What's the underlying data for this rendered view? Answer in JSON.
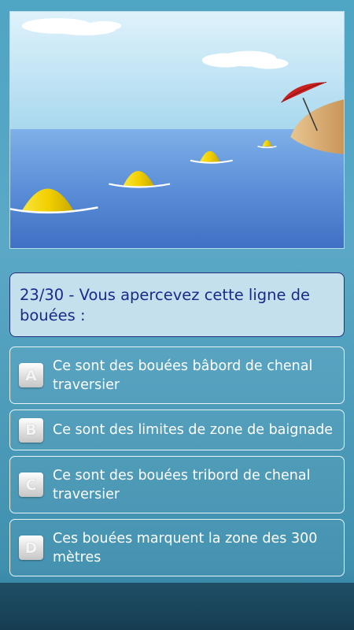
{
  "quiz": {
    "question": "23/30 - Vous apercevez cette ligne de bouées :",
    "answers": [
      {
        "letter": "A",
        "text": "Ce sont des bouées bâbord de chenal traversier"
      },
      {
        "letter": "B",
        "text": "Ce sont des limites de zone de baignade"
      },
      {
        "letter": "C",
        "text": "Ce sont des bouées tribord de chenal traversier"
      },
      {
        "letter": "D",
        "text": "Ces bouées marquent la zone des 300 mètres"
      }
    ]
  },
  "colors": {
    "question_text": "#1a2a8a",
    "question_bg": "#c5e0ed",
    "buoy": "#f2d400",
    "sea": "#5b8fd8",
    "umbrella": "#d42a2a"
  },
  "illustration": {
    "icon": "buoy-line-illustration"
  }
}
